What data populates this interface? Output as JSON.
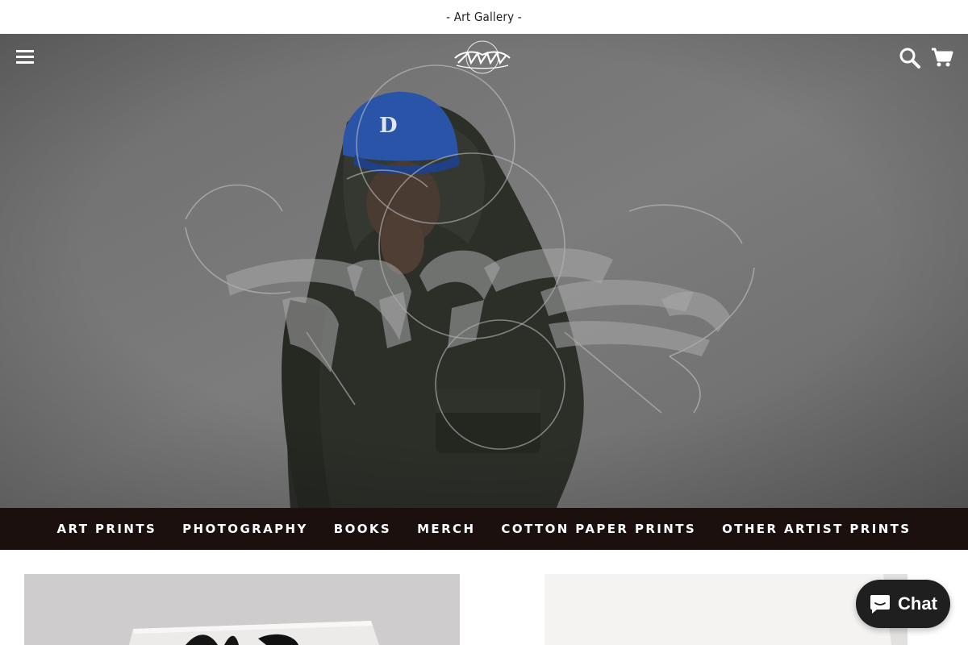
{
  "announcement": {
    "text": "- Art Gallery -"
  },
  "header": {
    "menu_icon": "hamburger-menu-icon",
    "search_icon": "search-icon",
    "cart_icon": "shopping-cart-icon"
  },
  "nav": {
    "items": [
      {
        "label": "ART PRINTS"
      },
      {
        "label": "PHOTOGRAPHY"
      },
      {
        "label": "BOOKS"
      },
      {
        "label": "MERCH"
      },
      {
        "label": "COTTON PAPER PRINTS"
      },
      {
        "label": "OTHER ARTIST PRINTS"
      }
    ]
  },
  "chat": {
    "label": "Chat",
    "icon": "chat-bubble-icon"
  },
  "colors": {
    "nav_bg": "#1c100f",
    "chat_bg": "#1f1f1f",
    "cap_blue": "#2a54a8"
  }
}
